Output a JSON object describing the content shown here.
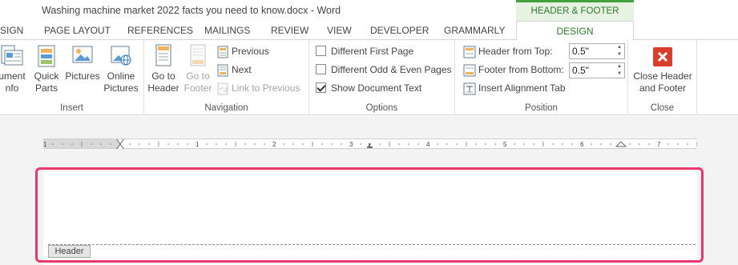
{
  "window": {
    "title": "Washing machine market 2022 facts you need to know.docx - Word"
  },
  "contextual_header": "HEADER & FOOTER TOOLS",
  "tabs": [
    "SIGN",
    "PAGE LAYOUT",
    "REFERENCES",
    "MAILINGS",
    "REVIEW",
    "VIEW",
    "DEVELOPER",
    "GRAMMARLY",
    "DESIGN"
  ],
  "ribbon": {
    "insert": {
      "label": "Insert",
      "document_info_l1": "ument",
      "document_info_l2": "nfo",
      "quick_parts_l1": "Quick",
      "quick_parts_l2": "Parts",
      "pictures": "Pictures",
      "online_pictures_l1": "Online",
      "online_pictures_l2": "Pictures"
    },
    "navigation": {
      "label": "Navigation",
      "go_to_header_l1": "Go to",
      "go_to_header_l2": "Header",
      "go_to_footer_l1": "Go to",
      "go_to_footer_l2": "Footer",
      "previous": "Previous",
      "next": "Next",
      "link_to_previous": "Link to Previous"
    },
    "options": {
      "label": "Options",
      "different_first_page": "Different First Page",
      "different_odd_even": "Different Odd & Even Pages",
      "show_document_text": "Show Document Text"
    },
    "position": {
      "label": "Position",
      "header_from_top": "Header from Top:",
      "header_value": "0.5\"",
      "footer_from_bottom": "Footer from Bottom:",
      "footer_value": "0.5\"",
      "insert_alignment_tab": "Insert Alignment Tab"
    },
    "close": {
      "label": "Close",
      "close_l1": "Close Header",
      "close_l2": "and Footer"
    }
  },
  "ruler": {
    "numbers": [
      "1",
      "1",
      "2",
      "3",
      "4",
      "5",
      "6",
      "7"
    ]
  },
  "document": {
    "header_tag": "Header"
  },
  "colors": {
    "accent_green": "#41a13d",
    "highlight_pink": "#e8386e",
    "close_red": "#d9402b"
  },
  "icons": [
    "document-info-icon",
    "quick-parts-icon",
    "pictures-icon",
    "online-pictures-icon",
    "go-to-header-icon",
    "go-to-footer-icon",
    "previous-icon",
    "next-icon",
    "link-to-previous-icon",
    "header-from-top-icon",
    "footer-from-bottom-icon",
    "insert-alignment-tab-icon",
    "close-header-footer-icon"
  ]
}
